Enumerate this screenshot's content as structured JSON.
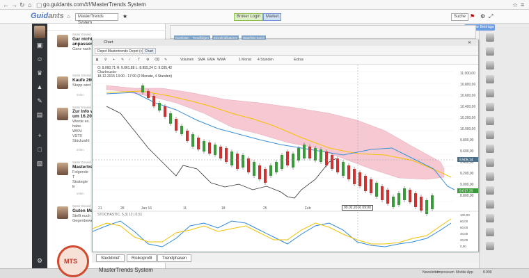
{
  "browser": {
    "url": "go.guidants.com/#!/MasterTrends System"
  },
  "app": {
    "logo_main": "Guid",
    "logo_tail": "ants",
    "workspace_select": "MasterTrends System",
    "broker_button": "Broker Login",
    "market_button": "Market",
    "suche": "Suche"
  },
  "feed": {
    "new_posts": "14 neue Beiträge",
    "items": [
      {
        "author": "Samir Esseid",
        "title": "Gar nicht",
        "title2": "anpassen",
        "text": "Ganz nach",
        "meta": ""
      },
      {
        "author": "Samir Esseid",
        "title": "Kaufe 260",
        "title2": "",
        "text": "Stopp wird",
        "meta": "teilen"
      },
      {
        "author": "Samir Esseid",
        "title": "Zur Info we",
        "title2": "um 16.200",
        "text": "Werde es. habe. WKN: VST0 Stückzahl:",
        "meta": "teilen"
      },
      {
        "author": "Samir Esseid",
        "title": "Mastertrer",
        "title2": "",
        "text": "Folgende T Strategie E",
        "meta": "teilen"
      },
      {
        "author": "Samir Esseid",
        "title": "Guten Mor",
        "title2": "",
        "text": "Stellt euch Gegenbewe",
        "meta": "teilen"
      }
    ]
  },
  "kurs_tabs": [
    "Kurslisten",
    "Trendfolgen",
    "Einzelindikatoren",
    "Watchlist Samir"
  ],
  "chart": {
    "window_title": "Chart",
    "tabs": [
      "Depot Mastertrends Depot (real)",
      "Chart"
    ],
    "toolbar": [
      "Volumen",
      "SMA",
      "EMA",
      "WMA",
      "1 Monat",
      "4 Stunden",
      "Extras"
    ],
    "info_line1": "O: 9.060,71  H: 9.061,88  L: 8.955,24  C: 9.035,42",
    "info_line2": "Chartmuster",
    "info_line3": "18.12.2015 13:00 - 17:00 (2 Monate, 4 Stunden)",
    "price_labels": [
      "11.000,00",
      "10.800,00",
      "10.600,00",
      "10.400,00",
      "10.200,00",
      "10.000,00",
      "9.800,00",
      "9.600,00",
      "9.400,00",
      "9.200,00",
      "9.000,00",
      "8.800,00"
    ],
    "current_price_tag": "9.505,14",
    "last_price_tag": "9.017,20",
    "date_labels": [
      "21",
      "28",
      "Jan 16",
      "11",
      "18",
      "25",
      "Feb",
      "8"
    ],
    "date_tip": "09.02.2016 09:00",
    "indicator_text": "STOCHASTIC, 5,3) 12 | 0,51",
    "ind_labels": [
      "100,00",
      "80,00",
      "60,00",
      "40,00",
      "20,00",
      "0,00"
    ]
  },
  "bottom_tabs": [
    "Steckbrief",
    "Risikoprofil",
    "Trendphasen"
  ],
  "mts": {
    "logo": "MTS",
    "title": "MasterTrends System"
  },
  "statusbar": {
    "newsletter": "Newsletter",
    "impressum": "Impressum",
    "mobile": "Mobile App",
    "count": "8.990"
  },
  "colors": {
    "cloud": "#f4b8c4",
    "kijun": "#f5c100",
    "tenkan": "#3b8fd6",
    "chikou": "#333333",
    "stoch_blue": "#2f89d8",
    "stoch_yellow": "#f2c200"
  }
}
